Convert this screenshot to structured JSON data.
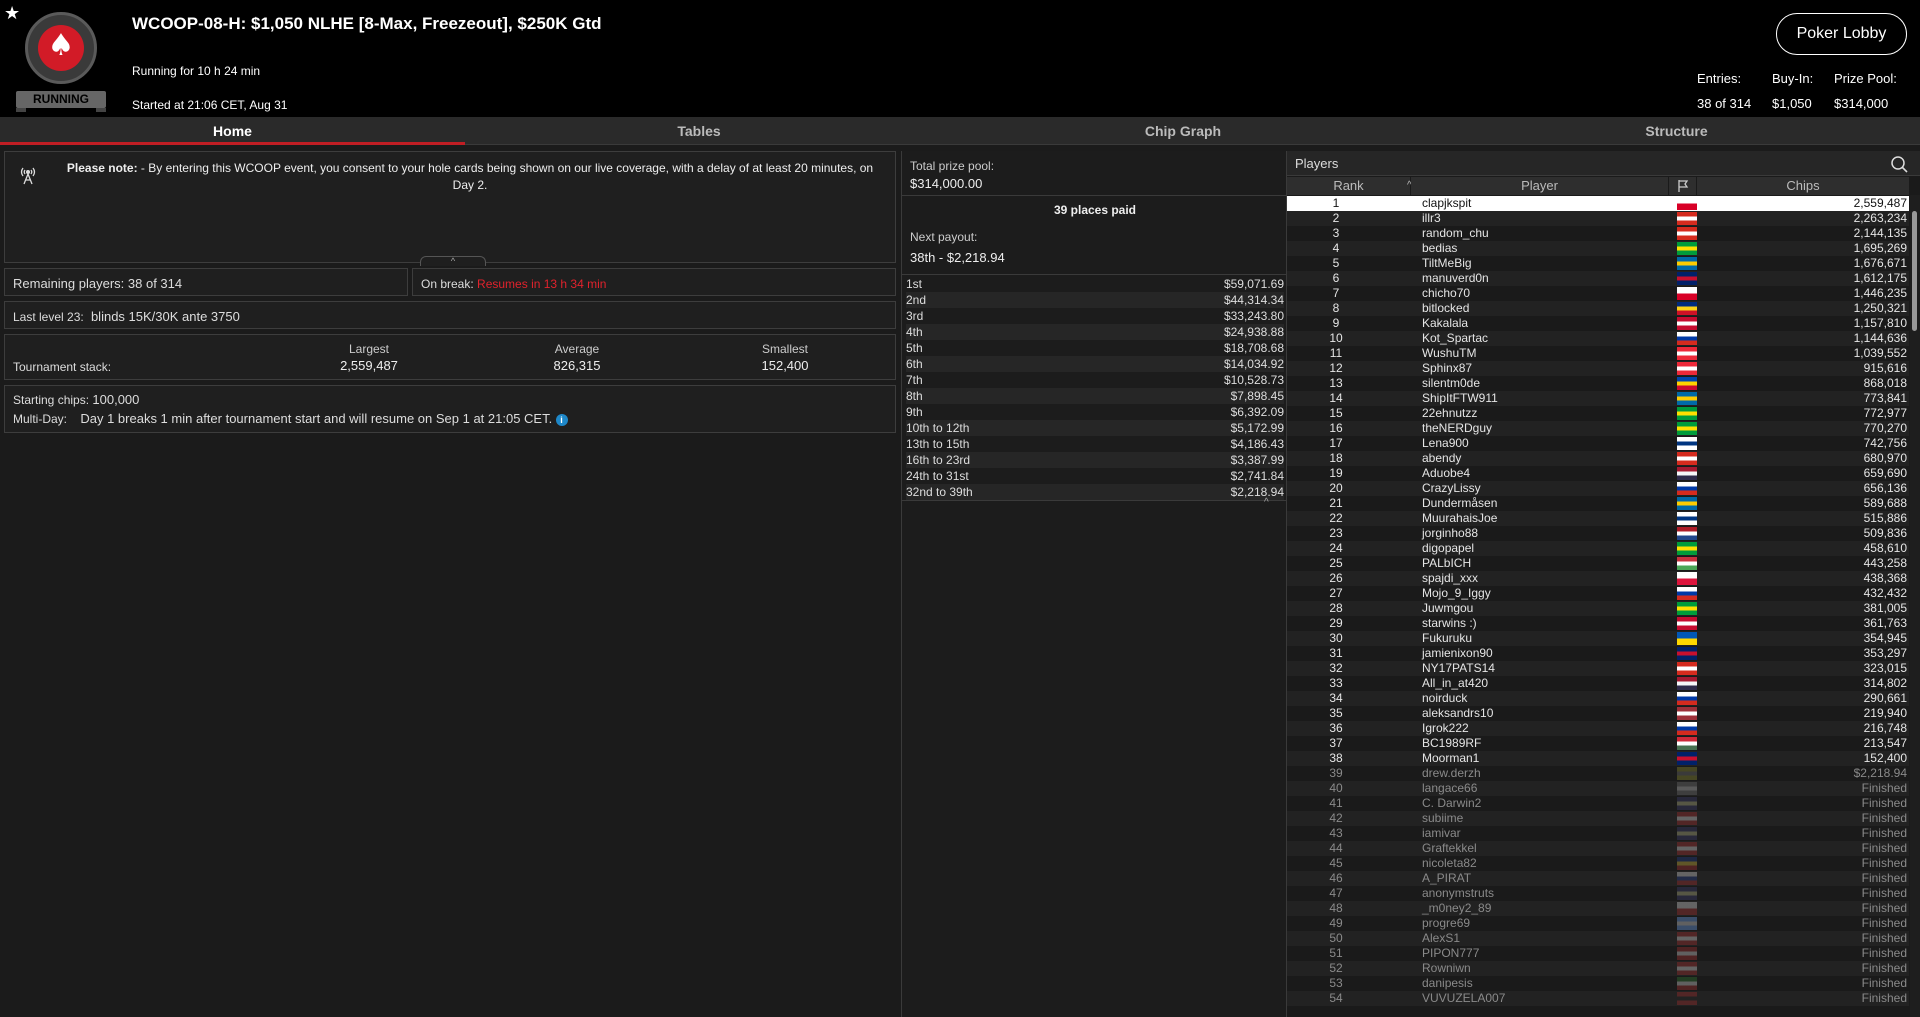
{
  "header": {
    "star_icon": "star-icon",
    "logo_icon": "pokerstars-logo",
    "status": "RUNNING",
    "title": "WCOOP-08-H: $1,050 NLHE [8-Max, Freezeout], $250K Gtd",
    "running_for": "Running for 10 h 24 min",
    "started_at": "Started at 21:06 CET, Aug 31",
    "lobby_button": "Poker Lobby",
    "entries_label": "Entries:",
    "entries_value": "38 of 314",
    "buyin_label": "Buy-In:",
    "buyin_value": "$1,050",
    "prizepool_label": "Prize Pool:",
    "prizepool_value": "$314,000"
  },
  "tabs": [
    {
      "label": "Home",
      "active": true
    },
    {
      "label": "Tables",
      "active": false
    },
    {
      "label": "Chip Graph",
      "active": false
    },
    {
      "label": "Structure",
      "active": false
    }
  ],
  "note": {
    "bold": "Please note:",
    "text": " - By entering this WCOOP event, you consent to your hole cards being shown on our live coverage, with a delay of at least 20 minutes, on Day 2."
  },
  "info": {
    "remaining_label": "Remaining players:",
    "remaining_value": "38 of 314",
    "break_label": "On break:",
    "break_value": "Resumes in 13 h 34 min",
    "level_label": "Last level 23:",
    "level_value": "blinds 15K/30K ante 3750",
    "stack_label": "Tournament stack:",
    "largest_label": "Largest",
    "largest_value": "2,559,487",
    "average_label": "Average",
    "average_value": "826,315",
    "smallest_label": "Smallest",
    "smallest_value": "152,400",
    "starting_label": "Starting chips:",
    "starting_value": "100,000",
    "multiday_label": "Multi-Day:",
    "multiday_value": "Day 1 breaks 1 min after tournament start and will resume on Sep 1 at 21:05 CET."
  },
  "prize": {
    "pool_label": "Total prize pool:",
    "pool_value": "$314,000.00",
    "places_paid": "39 places paid",
    "next_label": "Next payout:",
    "next_value": "38th - $2,218.94",
    "payouts": [
      {
        "place": "1st",
        "amount": "$59,071.69"
      },
      {
        "place": "2nd",
        "amount": "$44,314.34"
      },
      {
        "place": "3rd",
        "amount": "$33,243.80"
      },
      {
        "place": "4th",
        "amount": "$24,938.88"
      },
      {
        "place": "5th",
        "amount": "$18,708.68"
      },
      {
        "place": "6th",
        "amount": "$14,034.92"
      },
      {
        "place": "7th",
        "amount": "$10,528.73"
      },
      {
        "place": "8th",
        "amount": "$7,898.45"
      },
      {
        "place": "9th",
        "amount": "$6,392.09"
      },
      {
        "place": "10th to 12th",
        "amount": "$5,172.99"
      },
      {
        "place": "13th to 15th",
        "amount": "$4,186.43"
      },
      {
        "place": "16th to 23rd",
        "amount": "$3,387.99"
      },
      {
        "place": "24th to 31st",
        "amount": "$2,741.84"
      },
      {
        "place": "32nd to 39th",
        "amount": "$2,218.94"
      }
    ]
  },
  "players": {
    "title": "Players",
    "search_icon": "search-icon",
    "col_rank": "Rank",
    "col_player": "Player",
    "col_flag_icon": "flag-icon",
    "col_chips": "Chips",
    "rows": [
      {
        "rank": "1",
        "name": "clapjkspit",
        "chips": "2,559,487",
        "flag": [
          "#ffffff",
          "#d80027"
        ]
      },
      {
        "rank": "2",
        "name": "illr3",
        "chips": "2,263,234",
        "flag": [
          "#d52b1e",
          "#ffffff",
          "#d52b1e"
        ]
      },
      {
        "rank": "3",
        "name": "random_chu",
        "chips": "2,144,135",
        "flag": [
          "#d52b1e",
          "#ffffff",
          "#d52b1e"
        ]
      },
      {
        "rank": "4",
        "name": "bedias",
        "chips": "1,695,269",
        "flag": [
          "#009c3b",
          "#ffdf00",
          "#009c3b"
        ]
      },
      {
        "rank": "5",
        "name": "TiltMeBig",
        "chips": "1,676,671",
        "flag": [
          "#006aa7",
          "#fecc00",
          "#006aa7"
        ]
      },
      {
        "rank": "6",
        "name": "manuverd0n",
        "chips": "1,612,175",
        "flag": [
          "#012169",
          "#c8102e",
          "#012169"
        ]
      },
      {
        "rank": "7",
        "name": "chicho70",
        "chips": "1,446,235",
        "flag": [
          "#ffffff",
          "#d80027"
        ]
      },
      {
        "rank": "8",
        "name": "bitlocked",
        "chips": "1,250,321",
        "flag": [
          "#002b7f",
          "#fcd116",
          "#ce1126"
        ]
      },
      {
        "rank": "9",
        "name": "Kakalala",
        "chips": "1,157,810",
        "flag": [
          "#c60c30",
          "#ffffff",
          "#c60c30"
        ]
      },
      {
        "rank": "10",
        "name": "Kot_Spartac",
        "chips": "1,144,636",
        "flag": [
          "#ffffff",
          "#0039a6",
          "#d52b1e"
        ]
      },
      {
        "rank": "11",
        "name": "WushuTM",
        "chips": "1,039,552",
        "flag": [
          "#ed2939",
          "#ffffff",
          "#ed2939"
        ]
      },
      {
        "rank": "12",
        "name": "Sphinx87",
        "chips": "915,616",
        "flag": [
          "#ed2939",
          "#ffffff",
          "#ed2939"
        ]
      },
      {
        "rank": "13",
        "name": "silentm0de",
        "chips": "868,018",
        "flag": [
          "#0046ae",
          "#ffd200",
          "#cc092f"
        ]
      },
      {
        "rank": "14",
        "name": "ShipItFTW911",
        "chips": "773,841",
        "flag": [
          "#006aa7",
          "#fecc00",
          "#006aa7"
        ]
      },
      {
        "rank": "15",
        "name": "22ehnutzz",
        "chips": "772,977",
        "flag": [
          "#009c3b",
          "#ffdf00",
          "#009c3b"
        ]
      },
      {
        "rank": "16",
        "name": "theNERDguy",
        "chips": "770,270",
        "flag": [
          "#009c3b",
          "#ffdf00",
          "#009c3b"
        ]
      },
      {
        "rank": "17",
        "name": "Lena900",
        "chips": "742,756",
        "flag": [
          "#ffffff",
          "#003580",
          "#ffffff"
        ]
      },
      {
        "rank": "18",
        "name": "abendy",
        "chips": "680,970",
        "flag": [
          "#d52b1e",
          "#ffffff",
          "#d52b1e"
        ]
      },
      {
        "rank": "19",
        "name": "Aduobe4",
        "chips": "659,690",
        "flag": [
          "#a51931",
          "#f4f5f8",
          "#2d2a4a"
        ]
      },
      {
        "rank": "20",
        "name": "CrazyLissy",
        "chips": "656,136",
        "flag": [
          "#ffffff",
          "#0039a6",
          "#d52b1e"
        ]
      },
      {
        "rank": "21",
        "name": "Dundermåsen",
        "chips": "589,688",
        "flag": [
          "#006aa7",
          "#fecc00",
          "#006aa7"
        ]
      },
      {
        "rank": "22",
        "name": "MuurahaisJoe",
        "chips": "515,886",
        "flag": [
          "#ffffff",
          "#003580",
          "#ffffff"
        ]
      },
      {
        "rank": "23",
        "name": "jorginho88",
        "chips": "509,836",
        "flag": [
          "#ae1c28",
          "#ffffff",
          "#21468b"
        ]
      },
      {
        "rank": "24",
        "name": "digopapel",
        "chips": "458,610",
        "flag": [
          "#009c3b",
          "#ffdf00",
          "#009c3b"
        ]
      },
      {
        "rank": "25",
        "name": "PALbICH",
        "chips": "443,258",
        "flag": [
          "#c8313e",
          "#ffffff",
          "#4aa657"
        ]
      },
      {
        "rank": "26",
        "name": "spajdi_xxx",
        "chips": "438,368",
        "flag": [
          "#ffffff",
          "#dc143c"
        ]
      },
      {
        "rank": "27",
        "name": "Mojo_9_Iggy",
        "chips": "432,432",
        "flag": [
          "#ffffff",
          "#0039a6",
          "#d52b1e"
        ]
      },
      {
        "rank": "28",
        "name": "Juwmgou",
        "chips": "381,005",
        "flag": [
          "#009c3b",
          "#ffdf00",
          "#009c3b"
        ]
      },
      {
        "rank": "29",
        "name": "starwins :)",
        "chips": "361,763",
        "flag": [
          "#c60c30",
          "#ffffff",
          "#c60c30"
        ]
      },
      {
        "rank": "30",
        "name": "Fukuruku",
        "chips": "354,945",
        "flag": [
          "#0057b7",
          "#ffd700"
        ]
      },
      {
        "rank": "31",
        "name": "jamienixon90",
        "chips": "353,297",
        "flag": [
          "#012169",
          "#c8102e",
          "#012169"
        ]
      },
      {
        "rank": "32",
        "name": "NY17PATS14",
        "chips": "323,015",
        "flag": [
          "#d52b1e",
          "#ffffff",
          "#d52b1e"
        ]
      },
      {
        "rank": "33",
        "name": "All_in_at420",
        "chips": "314,802",
        "flag": [
          "#a51931",
          "#f4f5f8",
          "#2d2a4a"
        ]
      },
      {
        "rank": "34",
        "name": "noirduck",
        "chips": "290,661",
        "flag": [
          "#ffffff",
          "#0039a6",
          "#d52b1e"
        ]
      },
      {
        "rank": "35",
        "name": "aleksandrs10",
        "chips": "219,940",
        "flag": [
          "#9e3039",
          "#ffffff",
          "#9e3039"
        ]
      },
      {
        "rank": "36",
        "name": "Igrok222",
        "chips": "216,748",
        "flag": [
          "#ffffff",
          "#0039a6",
          "#d52b1e"
        ]
      },
      {
        "rank": "37",
        "name": "BC1989RF",
        "chips": "213,547",
        "flag": [
          "#ce2939",
          "#ffffff",
          "#477050"
        ]
      },
      {
        "rank": "38",
        "name": "Moorman1",
        "chips": "152,400",
        "flag": [
          "#012169",
          "#c8102e",
          "#012169"
        ]
      },
      {
        "rank": "39",
        "name": "drew.derzh",
        "chips": "$2,218.94",
        "flag": [
          "#6b6b2a",
          "#555555",
          "#6b6b2a"
        ],
        "finished": true
      },
      {
        "rank": "40",
        "name": "langace66",
        "chips": "Finished",
        "flag": [
          "#555555",
          "#888888",
          "#555555"
        ],
        "finished": true
      },
      {
        "rank": "41",
        "name": "C. Darwin2",
        "chips": "Finished",
        "flag": [
          "#335",
          "#886",
          "#335"
        ],
        "finished": true
      },
      {
        "rank": "42",
        "name": "subiime",
        "chips": "Finished",
        "flag": [
          "#7a2a2a",
          "#999999",
          "#7a2a2a"
        ],
        "finished": true
      },
      {
        "rank": "43",
        "name": "iamivar",
        "chips": "Finished",
        "flag": [
          "#335",
          "#886",
          "#335"
        ],
        "finished": true
      },
      {
        "rank": "44",
        "name": "Graftekkel",
        "chips": "Finished",
        "flag": [
          "#7a2a2a",
          "#999999",
          "#7a2a2a"
        ],
        "finished": true
      },
      {
        "rank": "45",
        "name": "nicoleta82",
        "chips": "Finished",
        "flag": [
          "#223366",
          "#998833",
          "#7a2a2a"
        ],
        "finished": true
      },
      {
        "rank": "46",
        "name": "A_PIRAT",
        "chips": "Finished",
        "flag": [
          "#999999",
          "#223366",
          "#7a2a2a"
        ],
        "finished": true
      },
      {
        "rank": "47",
        "name": "anonymstruts",
        "chips": "Finished",
        "flag": [
          "#335",
          "#886",
          "#335"
        ],
        "finished": true
      },
      {
        "rank": "48",
        "name": "_m0ney2_89",
        "chips": "Finished",
        "flag": [
          "#999999",
          "#7a2a2a"
        ],
        "finished": true
      },
      {
        "rank": "49",
        "name": "progre69",
        "chips": "Finished",
        "flag": [
          "#5577aa",
          "#999999",
          "#5577aa"
        ],
        "finished": true
      },
      {
        "rank": "50",
        "name": "AlexS1",
        "chips": "Finished",
        "flag": [
          "#7a2a2a",
          "#999999",
          "#7a2a2a"
        ],
        "finished": true
      },
      {
        "rank": "51",
        "name": "PIPON777",
        "chips": "Finished",
        "flag": [
          "#7a2a2a",
          "#999999",
          "#7a2a2a"
        ],
        "finished": true
      },
      {
        "rank": "52",
        "name": "Rowniwn",
        "chips": "Finished",
        "flag": [
          "#7a2a2a",
          "#999999",
          "#7a2a2a"
        ],
        "finished": true
      },
      {
        "rank": "53",
        "name": "danipesis",
        "chips": "Finished",
        "flag": [
          "#2a5a2a",
          "#999999",
          "#7a2a2a"
        ],
        "finished": true
      },
      {
        "rank": "54",
        "name": "VUVUZELA007",
        "chips": "Finished",
        "flag": [
          "#7a2a2a",
          "#222222",
          "#7a2a2a"
        ],
        "finished": true
      }
    ]
  },
  "colors": {
    "accent_red": "#c01e24",
    "break_red": "#e0222c",
    "background": "#1b1b1b",
    "header_bg": "#000000"
  }
}
